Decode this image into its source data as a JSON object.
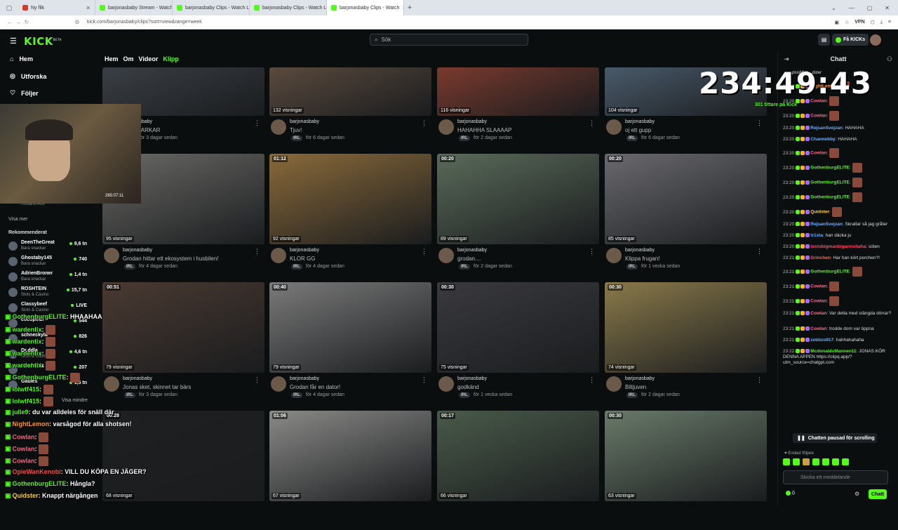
{
  "browser": {
    "tabs": [
      {
        "label": "Ny flik",
        "active": false,
        "color": "#d23b2a"
      },
      {
        "label": "barjonasbaby Stream - Watch L",
        "active": false,
        "color": "#53fc18"
      },
      {
        "label": "barjonasbaby Clips - Watch Liv",
        "active": false,
        "color": "#53fc18"
      },
      {
        "label": "barjonasbaby Clips - Watch Liv",
        "active": false,
        "color": "#53fc18"
      },
      {
        "label": "barjonasbaby Clips - Watch",
        "active": true,
        "color": "#53fc18"
      }
    ],
    "url": "kick.com/barjonasbaby/clips?sort=view&range=week",
    "vpn_label": "VPN"
  },
  "header": {
    "logo": "KICK",
    "logo_sup": "BETA",
    "search_placeholder": "Sök",
    "get_kicks_label": "Få KICKs"
  },
  "sidebar": {
    "nav": [
      {
        "label": "Hem",
        "icon": "home-icon"
      },
      {
        "label": "Utforska",
        "icon": "compass-icon"
      },
      {
        "label": "Följer",
        "icon": "heart-icon"
      }
    ],
    "following_partial_name": "Rickard0488",
    "show_more": "Visa mer",
    "recommended_title": "Rekommenderat",
    "recommended": [
      {
        "name": "DeenTheGreat",
        "category": "Bara snackar",
        "viewers": "9,6 tn"
      },
      {
        "name": "Ghostaby145",
        "category": "Bara snackar",
        "viewers": "740"
      },
      {
        "name": "AdrienBroner",
        "category": "Bara snackar",
        "viewers": "1,4 tn"
      },
      {
        "name": "ROSHTEIN",
        "category": "Slots & Casino",
        "viewers": "15,7 tn"
      },
      {
        "name": "Classybeef",
        "category": "Slots & Casino",
        "viewers": "LIVE"
      },
      {
        "name": "cocopinzi",
        "category": "",
        "viewers": "544"
      },
      {
        "name": "schneckyla",
        "category": "",
        "viewers": "826"
      },
      {
        "name": "Dr.ddla",
        "category": "Slots & Casino",
        "viewers": "4,6 tn"
      },
      {
        "name": "wardentix",
        "category": "",
        "viewers": "207"
      },
      {
        "name": "Gaules",
        "category": "",
        "viewers": "1,5 tn"
      }
    ],
    "show_less": "Visa mindre"
  },
  "channel_tabs": [
    {
      "label": "Hem",
      "active": false
    },
    {
      "label": "Om",
      "active": false
    },
    {
      "label": "Videor",
      "active": false
    },
    {
      "label": "Klipp",
      "active": true
    }
  ],
  "clips": [
    {
      "duration": "",
      "views": "",
      "channel": "barjonasbaby",
      "title": "...N SNARKAR",
      "tag": "IRL",
      "time": "för 3 dagar sedan",
      "bg": "#3a3f45"
    },
    {
      "duration": "",
      "views": "132 visningar",
      "channel": "barjonasbaby",
      "title": "Tjuv!",
      "tag": "IRL",
      "time": "för 6 dagar sedan",
      "bg": "#5a4a3e"
    },
    {
      "duration": "",
      "views": "116 visningar",
      "channel": "barjonasbaby",
      "title": "HAHAHHA SLAAAAP",
      "tag": "IRL",
      "time": "för 2 dagar sedan",
      "bg": "#7a3a2e"
    },
    {
      "duration": "",
      "views": "104 visningar",
      "channel": "barjonasbaby",
      "title": "oj ett gupp",
      "tag": "IRL",
      "time": "för 6 dagar sedan",
      "bg": "#4a5a6a"
    },
    {
      "duration": "",
      "views": "95 visningar",
      "channel": "barjonasbaby",
      "title": "Grodan hittar ett ekosystem i husbilen!",
      "tag": "IRL",
      "time": "för 4 dagar sedan",
      "bg": "#6a6a66"
    },
    {
      "duration": "01:12",
      "views": "92 visningar",
      "channel": "barjonasbaby",
      "title": "KLOR GG",
      "tag": "IRL",
      "time": "för 4 dagar sedan",
      "bg": "#8a6a3a"
    },
    {
      "duration": "00:20",
      "views": "89 visningar",
      "channel": "barjonasbaby",
      "title": "grodan....",
      "tag": "IRL",
      "time": "för 2 dagar sedan",
      "bg": "#5a6a5a"
    },
    {
      "duration": "00:20",
      "views": "85 visningar",
      "channel": "barjonasbaby",
      "title": "Klippa frugan!",
      "tag": "IRL",
      "time": "för 1 vecka sedan",
      "bg": "#6a6a6e"
    },
    {
      "duration": "00:51",
      "views": "79 visningar",
      "channel": "barjonasbaby",
      "title": "Jonas sket, skinnet tar bärs",
      "tag": "IRL",
      "time": "för 3 dagar sedan",
      "bg": "#4a3a32"
    },
    {
      "duration": "00:40",
      "views": "79 visningar",
      "channel": "barjonasbaby",
      "title": "Grodan får en dator!",
      "tag": "IRL",
      "time": "för 4 dagar sedan",
      "bg": "#7a7a7a"
    },
    {
      "duration": "00:30",
      "views": "75 visningar",
      "channel": "barjonasbaby",
      "title": "godkänd",
      "tag": "IRL",
      "time": "för 1 vecka sedan",
      "bg": "#3a3a3e"
    },
    {
      "duration": "00:30",
      "views": "74 visningar",
      "channel": "barjonasbaby",
      "title": "Biltjuven",
      "tag": "IRL",
      "time": "för 2 dagar sedan",
      "bg": "#8a7a4a"
    },
    {
      "duration": "00:28",
      "views": "68 visningar",
      "channel": "",
      "title": "",
      "tag": "",
      "time": "",
      "bg": "#1e2022"
    },
    {
      "duration": "01:06",
      "views": "67 visningar",
      "channel": "",
      "title": "",
      "tag": "",
      "time": "",
      "bg": "#8a8a88"
    },
    {
      "duration": "00:17",
      "views": "66 visningar",
      "channel": "",
      "title": "",
      "tag": "",
      "time": "",
      "bg": "#4a5a4a"
    },
    {
      "duration": "00:30",
      "views": "63 visningar",
      "channel": "",
      "title": "",
      "tag": "",
      "time": "",
      "bg": "#6a7a6a"
    }
  ],
  "chat": {
    "title": "Chatt",
    "messages": [
      {
        "time": "23:20",
        "user": "NightLemon",
        "color": "#ff9a2e",
        "text": "",
        "emote": true
      },
      {
        "time": "23:20",
        "user": "Cowlan",
        "color": "#ff6a8a",
        "text": "",
        "emote": true
      },
      {
        "time": "23:20",
        "user": "Cowlan",
        "color": "#ff6a8a",
        "text": "",
        "emote": true
      },
      {
        "time": "23:20",
        "user": "RejsanSvejzan",
        "color": "#6ab0ff",
        "text": "HAHAHA",
        "emote": false
      },
      {
        "time": "23:20",
        "user": "Channebby",
        "color": "#6ab0ff",
        "text": "HAHAHA",
        "emote": false
      },
      {
        "time": "23:20",
        "user": "Cowlan",
        "color": "#ff6a8a",
        "text": "",
        "emote": true
      },
      {
        "time": "23:20",
        "user": "GothenburgELITE",
        "color": "#53fc18",
        "text": "",
        "emote": true
      },
      {
        "time": "23:20",
        "user": "GothenburgELITE",
        "color": "#53fc18",
        "text": "",
        "emote": true
      },
      {
        "time": "23:20",
        "user": "GothenburgELITE",
        "color": "#53fc18",
        "text": "",
        "emote": true
      },
      {
        "time": "23:20",
        "user": "Quidster",
        "color": "#ffd23a",
        "text": "",
        "emote": true
      },
      {
        "time": "23:20",
        "user": "RejsanSvejzan",
        "color": "#6ab0ff",
        "text": "Skrattar så jag gråter",
        "emote": false
      },
      {
        "time": "23:20",
        "user": "tr1xta",
        "color": "#6ab0ff",
        "text": "han däcka ju",
        "emote": false
      },
      {
        "time": "23:20",
        "user": "testobigmanbigarmshaha",
        "color": "#ff4a6a",
        "text": "söten",
        "emote": false
      },
      {
        "time": "23:21",
        "user": "Grinchen",
        "color": "#ff6a4a",
        "text": "Har han kört porchen?!",
        "emote": false
      },
      {
        "time": "23:21",
        "user": "GothenburgELITE",
        "color": "#53fc18",
        "text": "",
        "emote": true
      },
      {
        "time": "23:21",
        "user": "Cowlan",
        "color": "#ff6a8a",
        "text": "",
        "emote": true
      },
      {
        "time": "23:21",
        "user": "Cowlan",
        "color": "#ff6a8a",
        "text": "",
        "emote": true
      },
      {
        "time": "23:21",
        "user": "Cowlan",
        "color": "#ff6a8a",
        "text": "Var detta med stängda dörrar?",
        "emote": false
      },
      {
        "time": "23:21",
        "user": "Cowlan",
        "color": "#ff6a8a",
        "text": "trodde dom var öppna",
        "emote": false
      },
      {
        "time": "23:21",
        "user": "zebbzo917",
        "color": "#6ab0ff",
        "text": "hahhahahaha",
        "emote": false
      },
      {
        "time": "23:22",
        "user": "McdonaldsMannen11",
        "color": "#53fc18",
        "text": "JONAS KÖR DENNA APPEN https://clipq.app/?utm_source=chatgpt.com",
        "emote": false
      }
    ],
    "paused_label": "Chatten pausad för scrolling",
    "followers_only": "Endast följare",
    "input_placeholder": "Skicka ett meddelande",
    "kicks_count": "0",
    "send_label": "Chatt"
  },
  "overlay": {
    "timer": "234:49:43",
    "viewers": "301 tittare på Kick",
    "chat_lines": [
      {
        "user": "GothenburgELITE",
        "text": "HHAAHAA"
      },
      {
        "user": "wardentix",
        "text": ""
      },
      {
        "user": "wardentix",
        "text": ""
      },
      {
        "user": "wardentix",
        "text": ""
      },
      {
        "user": "wardentix",
        "text": ""
      },
      {
        "user": "GothenburgELITE",
        "text": ""
      },
      {
        "user": "lolwtf415",
        "text": ""
      },
      {
        "user": "lolwtf415",
        "text": ""
      },
      {
        "user": "julle9",
        "text": "du var alldeles för snäll där"
      },
      {
        "user": "NightLemon",
        "text": "varsågod för alla shotsen!"
      },
      {
        "user": "Cowlan",
        "text": ""
      },
      {
        "user": "Cowlan",
        "text": ""
      },
      {
        "user": "Cowlan",
        "text": ""
      },
      {
        "user": "OpieWanKenobi",
        "text": "VILL DU KÖPA EN JÄGER?"
      },
      {
        "user": "GothenburgELITE",
        "text": "Hångla?"
      },
      {
        "user": "Quidster",
        "text": "Knappt närgången"
      }
    ],
    "top_chat_partial": "...plusMist ...dster",
    "ov_webcam_timestamp": "265:07:11"
  }
}
